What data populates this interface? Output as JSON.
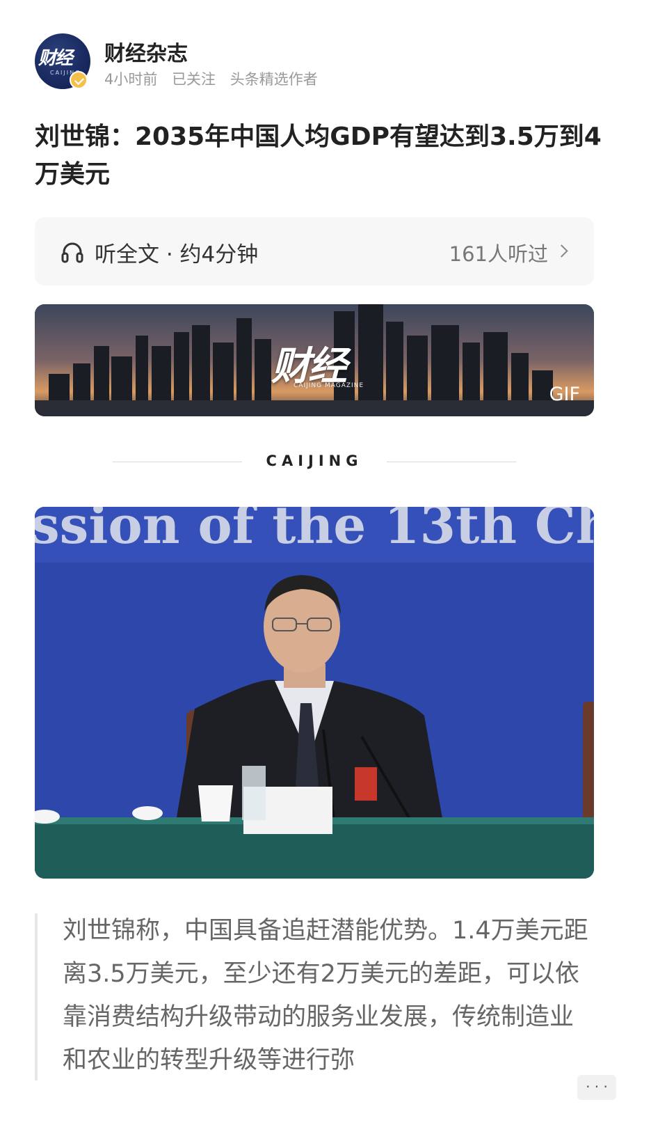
{
  "author": {
    "name": "财经杂志",
    "avatar_text": "财经",
    "avatar_sub": "CAIJING",
    "meta": [
      "4小时前",
      "已关注",
      "头条精选作者"
    ]
  },
  "article": {
    "title": "刘世锦：2035年中国人均GDP有望达到3.5万到4万美元"
  },
  "listen": {
    "label": "听全文 · 约4分钟",
    "count": "161人听过"
  },
  "banner": {
    "logo": "财经",
    "logo_sub": "CAIJING MAGAZINE",
    "badge": "GIF"
  },
  "divider": {
    "text": "CAIJING"
  },
  "photo": {
    "backdrop_text": "ssion of the 13th Ch"
  },
  "body": {
    "paragraph": "刘世锦称，中国具备追赶潜能优势。1.4万美元距离3.5万美元，至少还有2万美元的差距，可以依靠消费结构升级带动的服务业发展，传统制造业和农业的转型升级等进行弥"
  },
  "icons": {
    "listen": "headphone-icon",
    "more": "chevron-right-icon",
    "verified": "verify-badge-icon",
    "overflow": "more-icon"
  },
  "colors": {
    "accent_badge": "#f3c14b",
    "avatar_bg": "#15265a",
    "photo_backdrop": "#2d45a8"
  }
}
